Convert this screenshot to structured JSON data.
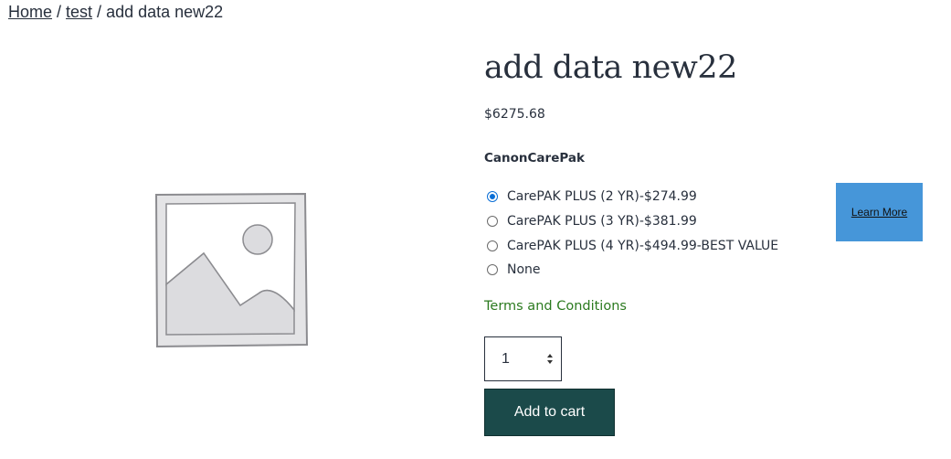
{
  "breadcrumb": {
    "home": "Home",
    "sep1": " / ",
    "category": "test",
    "sep2": " / ",
    "current": "add data new22"
  },
  "product": {
    "image_icon": "image-placeholder-icon",
    "title": "add data new22",
    "price": "$6275.68"
  },
  "care_pak": {
    "label": "CanonCarePak",
    "options": [
      {
        "label": "CarePAK PLUS (2 YR)-$274.99",
        "selected": true
      },
      {
        "label": "CarePAK PLUS (3 YR)-$381.99",
        "selected": false
      },
      {
        "label": "CarePAK PLUS (4 YR)-$494.99-BEST VALUE",
        "selected": false
      },
      {
        "label": "None",
        "selected": false
      }
    ],
    "learn_more_label": "Learn More"
  },
  "terms_label": "Terms and Conditions",
  "quantity": {
    "value": "1"
  },
  "cart": {
    "add_label": "Add to cart"
  },
  "colors": {
    "text": "#28303d",
    "radio_accent": "#0b6fd6",
    "learn_more_bg": "#4696d9",
    "terms_link": "#2b7a1f",
    "add_to_cart_bg": "#1b4a4a"
  }
}
